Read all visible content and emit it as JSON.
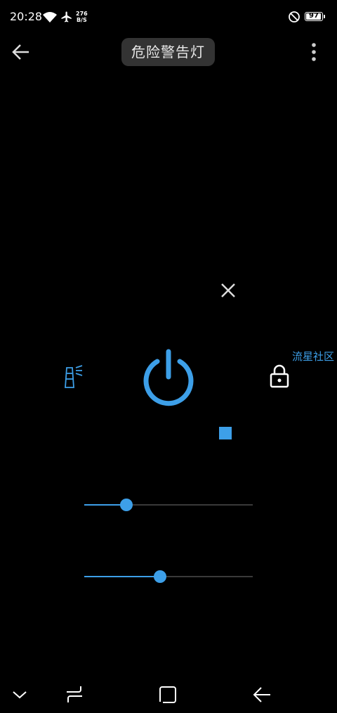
{
  "status_bar": {
    "time": "20:28",
    "net_speed_value": "276",
    "net_speed_unit": "B/S",
    "battery": "97",
    "battery_percent": 97,
    "icons": [
      "wifi-icon",
      "airplane-icon",
      "do-not-disturb-icon",
      "battery-icon"
    ]
  },
  "app_bar": {
    "title": "危险警告灯",
    "icons": [
      "arrow-back-icon",
      "more-vert-icon"
    ]
  },
  "controls": {
    "icons": [
      "close-icon",
      "lighthouse-icon",
      "power-icon",
      "lock-icon",
      "stop-icon"
    ],
    "watermark": "流星社区"
  },
  "sliders": [
    {
      "name": "slider-1",
      "value": 0.25
    },
    {
      "name": "slider-2",
      "value": 0.45
    }
  ],
  "colors": {
    "accent": "#3d9fe8",
    "background": "#000000",
    "title_chip": "#333333"
  },
  "nav_bar": {
    "icons": [
      "chevron-down-icon",
      "recent-apps-icon",
      "home-icon",
      "back-icon"
    ]
  }
}
